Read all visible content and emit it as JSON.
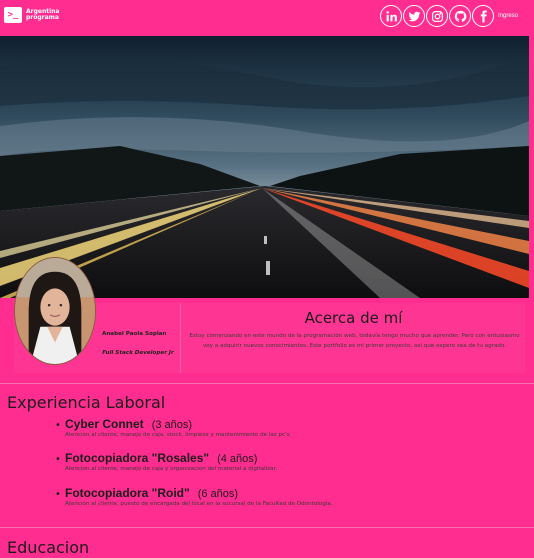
{
  "navbar": {
    "brand_icon": "terminal-icon",
    "brand_text": "Argentina programa",
    "socials": [
      {
        "name": "linkedin-icon"
      },
      {
        "name": "twitter-icon"
      },
      {
        "name": "instagram-icon"
      },
      {
        "name": "github-icon"
      },
      {
        "name": "facebook-icon"
      }
    ],
    "login_label": "Ingreso"
  },
  "profile": {
    "name": "Anabel Paola Soplan",
    "role": "Full Stack Developer Jr"
  },
  "about": {
    "title": "Acerca de mí",
    "text": "Estoy comenzando en este mundo de la programación web, todavía tengo mucho que aprender. Pero con entusiasmo voy a adquirir nuevos conocimientos. Este portfolio es mi primer proyecto, así que espero sea de tu agrado."
  },
  "experience": {
    "title": "Experiencia Laboral",
    "items": [
      {
        "title": "Cyber Connet",
        "years": "(3 años)",
        "description": "Atención al cliente, manejo de caja, stock, limpieza y mantenimiento de las pc's."
      },
      {
        "title": "Fotocopiadora \"Rosales\"",
        "years": "(4 años)",
        "description": "Atención al cliente, manejo de caja y organización del material a digitalizar."
      },
      {
        "title": "Fotocopiadora \"Roid\"",
        "years": "(6 años)",
        "description": "Atención al cliente, puesto de encargada del local en la sucursal de la Facultad de Odontología."
      }
    ]
  },
  "education": {
    "title": "Educacion"
  },
  "colors": {
    "background": "#ff2d8f",
    "text": "#1c1c1c"
  }
}
